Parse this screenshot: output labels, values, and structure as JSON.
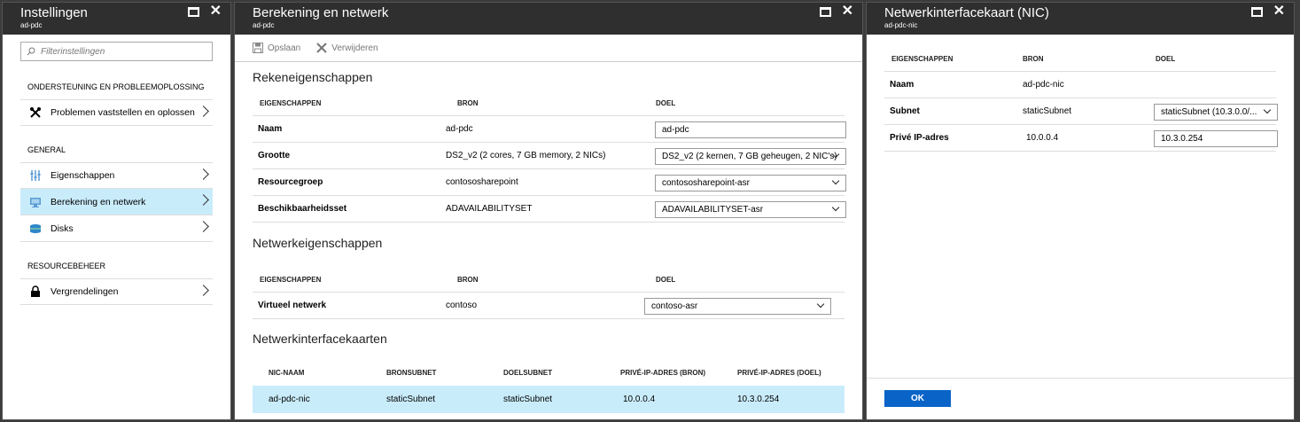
{
  "blade1": {
    "title": "Instellingen",
    "subtitle": "ad-pdc",
    "search_placeholder": "Filterinstellingen",
    "sections": [
      {
        "label": "ONDERSTEUNING EN PROBLEEMOPLOSSING",
        "items": [
          {
            "label": "Problemen vaststellen en oplossen",
            "icon": "wrench-icon"
          }
        ]
      },
      {
        "label": "GENERAL",
        "items": [
          {
            "label": "Eigenschappen",
            "icon": "properties-icon"
          },
          {
            "label": "Berekening en netwerk",
            "icon": "monitor-icon"
          },
          {
            "label": "Disks",
            "icon": "disks-icon"
          }
        ]
      },
      {
        "label": "RESOURCEBEHEER",
        "items": [
          {
            "label": "Vergrendelingen",
            "icon": "lock-icon"
          }
        ]
      }
    ]
  },
  "blade2": {
    "title": "Berekening en netwerk",
    "subtitle": "ad-pdc",
    "toolbar": {
      "save": "Opslaan",
      "delete": "Verwijderen"
    },
    "compute": {
      "title": "Rekeneigenschappen",
      "headers": [
        "EIGENSCHAPPEN",
        "BRON",
        "DOEL"
      ],
      "rows": [
        {
          "prop": "Naam",
          "source": "ad-pdc",
          "target": "ad-pdc"
        },
        {
          "prop": "Grootte",
          "source": "DS2_v2 (2 cores, 7 GB memory, 2 NICs)",
          "target": "DS2_v2 (2 kernen, 7 GB geheugen, 2 NIC's)"
        },
        {
          "prop": "Resourcegroep",
          "source": "contososharepoint",
          "target": "contososharepoint-asr"
        },
        {
          "prop": "Beschikbaarheidsset",
          "source": "ADAVAILABILITYSET",
          "target": "ADAVAILABILITYSET-asr"
        }
      ]
    },
    "network": {
      "title": "Netwerkeigenschappen",
      "headers": [
        "EIGENSCHAPPEN",
        "BRON",
        "DOEL"
      ],
      "rows": [
        {
          "prop": "Virtueel netwerk",
          "source": "contoso",
          "target": "contoso-asr"
        }
      ]
    },
    "nics": {
      "title": "Netwerkinterfacekaarten",
      "headers": [
        "NIC-NAAM",
        "BRONSUBNET",
        "DOELSUBNET",
        "PRIVÉ-IP-ADRES (BRON)",
        "PRIVÉ-IP-ADRES (DOEL)"
      ],
      "rows": [
        {
          "name": "ad-pdc-nic",
          "src_subnet": "staticSubnet",
          "tgt_subnet": "staticSubnet",
          "src_ip": "10.0.0.4",
          "tgt_ip": "10.3.0.254"
        }
      ]
    }
  },
  "blade3": {
    "title": "Netwerkinterfacekaart (NIC)",
    "subtitle": "ad-pdc-nic",
    "headers": [
      "EIGENSCHAPPEN",
      "BRON",
      "DOEL"
    ],
    "rows": [
      {
        "prop": "Naam",
        "source": "ad-pdc-nic",
        "target": ""
      },
      {
        "prop": "Subnet",
        "source": "staticSubnet",
        "target": "staticSubnet (10.3.0.0/..."
      },
      {
        "prop": "Privé IP-adres",
        "source": "10.0.0.4",
        "target": "10.3.0.254"
      }
    ],
    "ok": "OK"
  },
  "colors": {
    "header_bg": "#2f2f2f",
    "selected_bg": "#c9ecfb",
    "ok_blue": "#0a64c8"
  }
}
